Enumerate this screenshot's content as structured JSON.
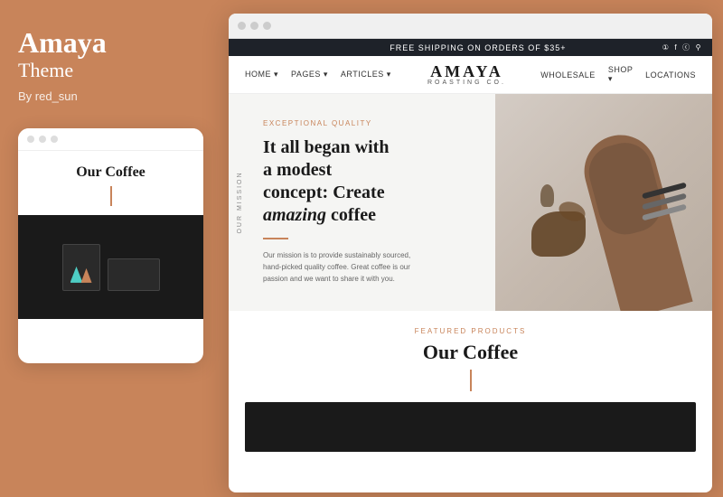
{
  "left": {
    "title": "Amaya",
    "subtitle": "Theme",
    "author": "By red_sun",
    "mini_preview": {
      "heading": "Our Coffee",
      "dots": [
        "dot1",
        "dot2",
        "dot3"
      ]
    }
  },
  "browser": {
    "dots": [
      "dot1",
      "dot2",
      "dot3"
    ]
  },
  "announcement": {
    "text": "FREE SHIPPING ON ORDERS OF $35+",
    "icons": [
      "instagram",
      "facebook",
      "camera",
      "search"
    ]
  },
  "nav": {
    "left_items": [
      {
        "label": "HOME"
      },
      {
        "label": "PAGES"
      },
      {
        "label": "ARTICLES"
      }
    ],
    "logo": {
      "main": "AMAYA",
      "sub": "ROASTING CO."
    },
    "right_items": [
      {
        "label": "WHOLESALE"
      },
      {
        "label": "SHOP"
      },
      {
        "label": "LOCATIONS"
      }
    ]
  },
  "hero": {
    "mission_label": "OUR MISSION",
    "tag": "EXCEPTIONAL QUALITY",
    "heading_line1": "It all began with",
    "heading_line2": "a modest",
    "heading_line3": "concept: Create",
    "heading_line4_normal": "",
    "heading_line4_italic": "amazing",
    "heading_line4_end": " coffee",
    "body": "Our mission is to provide sustainably sourced, hand-picked quality coffee. Great coffee is our passion and we want to share it with you."
  },
  "products": {
    "tag": "FEATURED PRODUCTS",
    "heading": "Our Coffee"
  }
}
